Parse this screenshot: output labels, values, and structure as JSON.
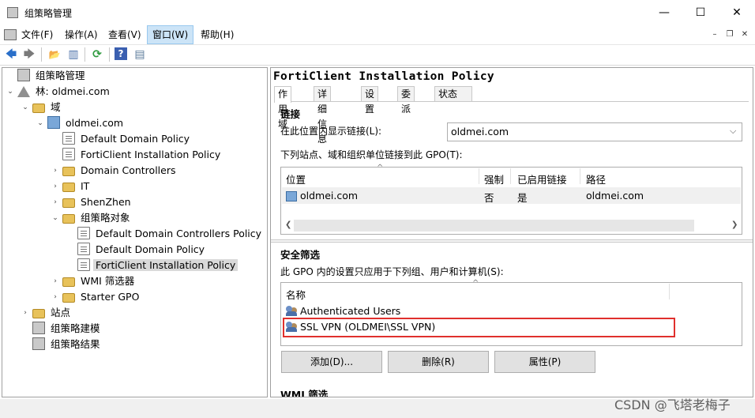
{
  "window": {
    "title": "组策略管理",
    "controls": {
      "minimize": "—",
      "maximize": "☐",
      "close": "✕"
    }
  },
  "menubar": {
    "items": [
      "文件(F)",
      "操作(A)",
      "查看(V)",
      "窗口(W)",
      "帮助(H)"
    ],
    "active_index": 3,
    "mdi": {
      "minimize": "–",
      "restore": "❐",
      "close": "✕"
    }
  },
  "toolbar": {
    "back": "🡄",
    "forward": "🡆",
    "up": "📂",
    "show_tree": "▥",
    "refresh": "⟳",
    "help": "?",
    "properties": "▤"
  },
  "tree": {
    "items": [
      {
        "label": "组策略管理",
        "icon": "gpm-icon",
        "depth": 0,
        "twisty": ""
      },
      {
        "label": "林: oldmei.com",
        "icon": "forest-icon",
        "depth": 0,
        "twisty": "⌄"
      },
      {
        "label": "域",
        "icon": "folder-icon",
        "depth": 1,
        "twisty": "⌄"
      },
      {
        "label": "oldmei.com",
        "icon": "domain-icon",
        "depth": 2,
        "twisty": "⌄"
      },
      {
        "label": "Default Domain Policy",
        "icon": "gpo-link-icon",
        "depth": 3,
        "twisty": ""
      },
      {
        "label": "FortiClient Installation Policy",
        "icon": "gpo-link-icon",
        "depth": 3,
        "twisty": ""
      },
      {
        "label": "Domain Controllers",
        "icon": "ou-folder-icon",
        "depth": 3,
        "twisty": "›"
      },
      {
        "label": "IT",
        "icon": "ou-folder-icon",
        "depth": 3,
        "twisty": "›"
      },
      {
        "label": "ShenZhen",
        "icon": "ou-folder-icon",
        "depth": 3,
        "twisty": "›"
      },
      {
        "label": "组策略对象",
        "icon": "folder-icon",
        "depth": 3,
        "twisty": "⌄"
      },
      {
        "label": "Default Domain Controllers Policy",
        "icon": "gpo-icon",
        "depth": 4,
        "twisty": ""
      },
      {
        "label": "Default Domain Policy",
        "icon": "gpo-icon",
        "depth": 4,
        "twisty": ""
      },
      {
        "label": "FortiClient Installation Policy",
        "icon": "gpo-icon",
        "depth": 4,
        "twisty": "",
        "selected": true
      },
      {
        "label": "WMI 筛选器",
        "icon": "folder-icon",
        "depth": 3,
        "twisty": "›"
      },
      {
        "label": "Starter GPO",
        "icon": "folder-icon",
        "depth": 3,
        "twisty": "›"
      },
      {
        "label": "站点",
        "icon": "sites-icon",
        "depth": 1,
        "twisty": "›"
      },
      {
        "label": "组策略建模",
        "icon": "modeling-icon",
        "depth": 1,
        "twisty": ""
      },
      {
        "label": "组策略结果",
        "icon": "results-icon",
        "depth": 1,
        "twisty": ""
      }
    ]
  },
  "detail": {
    "title": "FortiClient Installation Policy",
    "tabs": [
      "作用域",
      "详细信息",
      "设置",
      "委派",
      "状态"
    ],
    "active_tab": 0,
    "links": {
      "section_title": "链接",
      "location_label": "在此位置内显示链接(L):",
      "location_value": "oldmei.com",
      "list_label": "下列站点、域和组织单位链接到此 GPO(T):",
      "columns": [
        "位置",
        "强制",
        "已启用链接",
        "路径"
      ],
      "rows": [
        {
          "location": "oldmei.com",
          "enforced": "否",
          "enabled": "是",
          "path": "oldmei.com"
        }
      ]
    },
    "security": {
      "section_title": "安全筛选",
      "desc": "此 GPO 内的设置只应用于下列组、用户和计算机(S):",
      "column": "名称",
      "rows": [
        "Authenticated Users",
        "SSL VPN (OLDMEI\\SSL VPN)"
      ],
      "buttons": {
        "add": "添加(D)...",
        "remove": "删除(R)",
        "properties": "属性(P)"
      }
    },
    "next_section_partial": "WMI 筛选"
  },
  "watermark": "CSDN @飞塔老梅子"
}
